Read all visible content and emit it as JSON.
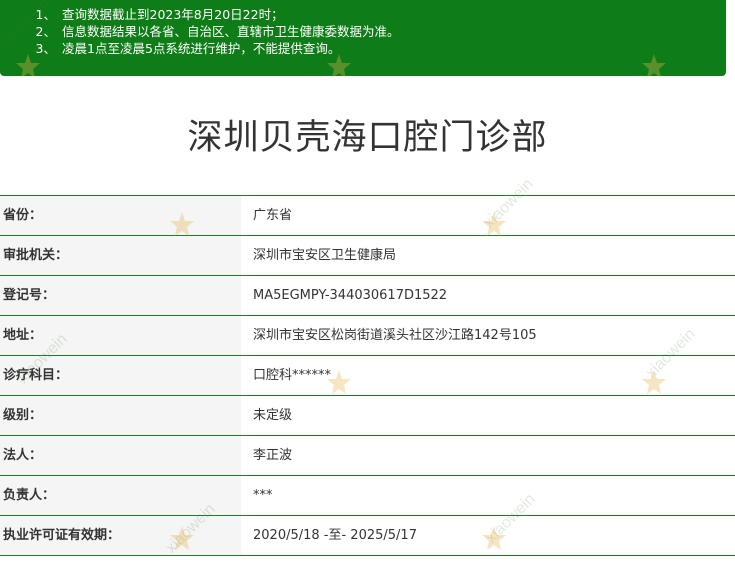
{
  "notice": {
    "items": [
      {
        "num": "1、",
        "text": "查询数据截止到2023年8月20日22时；"
      },
      {
        "num": "2、",
        "text": "信息数据结果以各省、自治区、直辖市卫生健康委数据为准。"
      },
      {
        "num": "3、",
        "text": "凌晨1点至凌晨5点系统进行维护，不能提供查询。"
      }
    ]
  },
  "page_title": "深圳贝壳海口腔门诊部",
  "fields": [
    {
      "label": "省份：",
      "value": "广东省"
    },
    {
      "label": "审批机关：",
      "value": "深圳市宝安区卫生健康局"
    },
    {
      "label": "登记号：",
      "value": "MA5EGMPY-344030617D1522"
    },
    {
      "label": "地址：",
      "value": "深圳市宝安区松岗街道溪头社区沙江路142号105"
    },
    {
      "label": "诊疗科目：",
      "value": "口腔科******"
    },
    {
      "label": "级别：",
      "value": "未定级"
    },
    {
      "label": "法人：",
      "value": "李正波"
    },
    {
      "label": "负责人：",
      "value": "***"
    },
    {
      "label": "执业许可证有效期：",
      "value": "2020/5/18 -至- 2025/5/17"
    }
  ],
  "watermark": {
    "text": "xiaowein",
    "icon": "star-logo-icon"
  },
  "colors": {
    "notice_bg": "#0f7d17",
    "row_border": "#1f7a2a",
    "label_bg": "#f5f5f5",
    "text": "#333333"
  }
}
